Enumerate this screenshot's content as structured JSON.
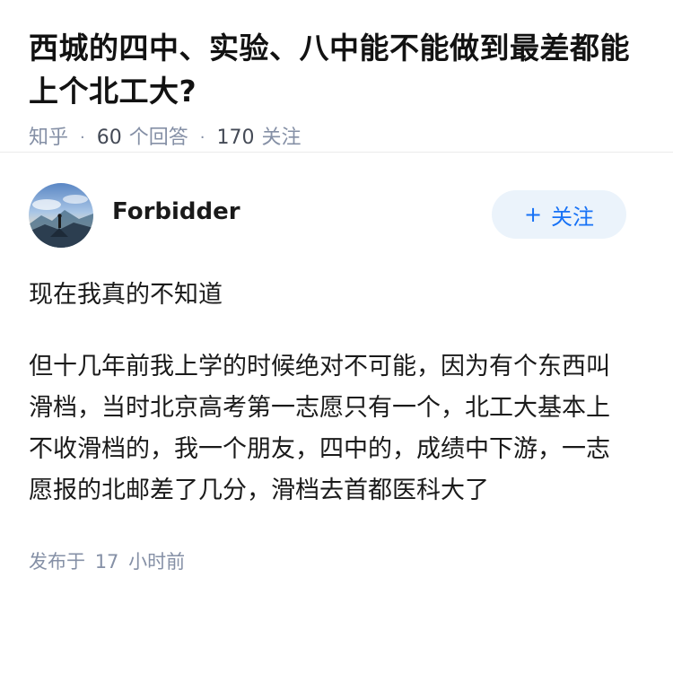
{
  "question": {
    "title": "西城的四中、实验、八中能不能做到最差都能上个北工大?",
    "meta": {
      "site": "知乎",
      "answers_count": "60",
      "answers_label": "个回答",
      "followers_count": "170",
      "followers_label": "关注"
    }
  },
  "answer": {
    "author": {
      "name": "Forbidder",
      "follow_label": "关注",
      "follow_icon": "plus-icon"
    },
    "paragraphs": [
      "现在我真的不知道",
      "但十几年前我上学的时候绝对不可能，因为有个东西叫滑档，当时北京高考第一志愿只有一个，北工大基本上不收滑档的，我一个朋友，四中的，成绩中下游，一志愿报的北邮差了几分，滑档去首都医科大了"
    ],
    "publish": {
      "prefix": "发布于",
      "value": "17",
      "unit": "小时前"
    }
  },
  "colors": {
    "accent": "#1772f6",
    "follow_bg": "#ebf3fb",
    "meta_text": "#8590a6"
  }
}
